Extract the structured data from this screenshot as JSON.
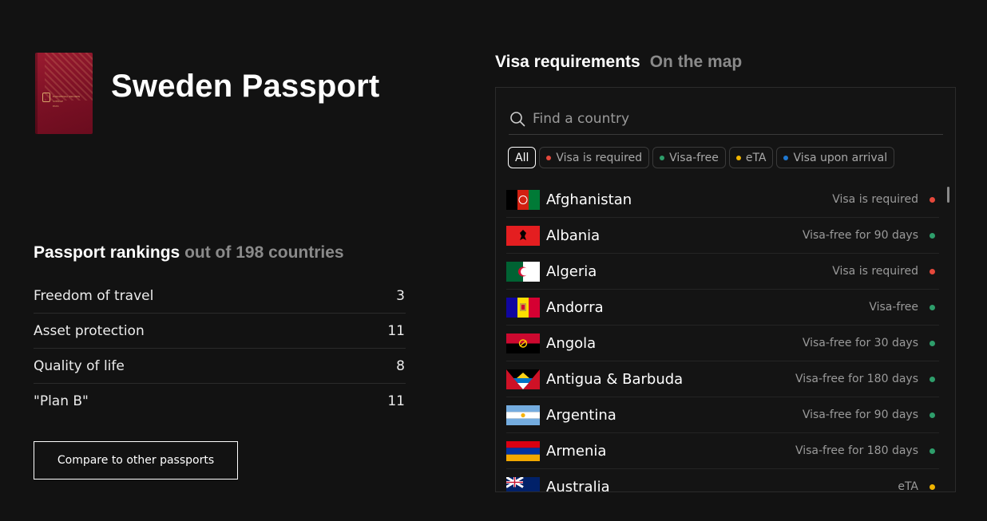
{
  "passport": {
    "title": "Sweden Passport",
    "cover_text": "EUROPEISKA UNIONEN\nSVERIGE\nPASS",
    "cover_color": "#7a1024"
  },
  "rankings": {
    "heading": "Passport rankings",
    "heading_muted": "out of 198 countries",
    "rows": [
      {
        "label": "Freedom of travel",
        "value": "3"
      },
      {
        "label": "Asset protection",
        "value": "11"
      },
      {
        "label": "Quality of life",
        "value": "8"
      },
      {
        "label": "\"Plan B\"",
        "value": "11"
      }
    ]
  },
  "compare_button": "Compare to other passports",
  "visa": {
    "tab_active": "Visa requirements",
    "tab_inactive": "On the map",
    "search_placeholder": "Find a country",
    "filters": [
      {
        "label": "All",
        "dot_color": null,
        "active": true
      },
      {
        "label": "Visa is required",
        "dot_color": "#e5483b",
        "active": false
      },
      {
        "label": "Visa-free",
        "dot_color": "#2e9e6b",
        "active": false
      },
      {
        "label": "eTA",
        "dot_color": "#f0b400",
        "active": false
      },
      {
        "label": "Visa upon arrival",
        "dot_color": "#1f78d1",
        "active": false
      }
    ],
    "countries": [
      {
        "name": "Afghanistan",
        "status": "Visa is required",
        "status_color": "#e5483b",
        "flag": "afghanistan"
      },
      {
        "name": "Albania",
        "status": "Visa-free for 90 days",
        "status_color": "#2e9e6b",
        "flag": "albania"
      },
      {
        "name": "Algeria",
        "status": "Visa is required",
        "status_color": "#e5483b",
        "flag": "algeria"
      },
      {
        "name": "Andorra",
        "status": "Visa-free",
        "status_color": "#2e9e6b",
        "flag": "andorra"
      },
      {
        "name": "Angola",
        "status": "Visa-free for 30 days",
        "status_color": "#2e9e6b",
        "flag": "angola"
      },
      {
        "name": "Antigua & Barbuda",
        "status": "Visa-free for 180 days",
        "status_color": "#2e9e6b",
        "flag": "antigua"
      },
      {
        "name": "Argentina",
        "status": "Visa-free for 90 days",
        "status_color": "#2e9e6b",
        "flag": "argentina"
      },
      {
        "name": "Armenia",
        "status": "Visa-free for 180 days",
        "status_color": "#2e9e6b",
        "flag": "armenia"
      },
      {
        "name": "Australia",
        "status": "eTA",
        "status_color": "#f0b400",
        "flag": "australia"
      }
    ]
  }
}
